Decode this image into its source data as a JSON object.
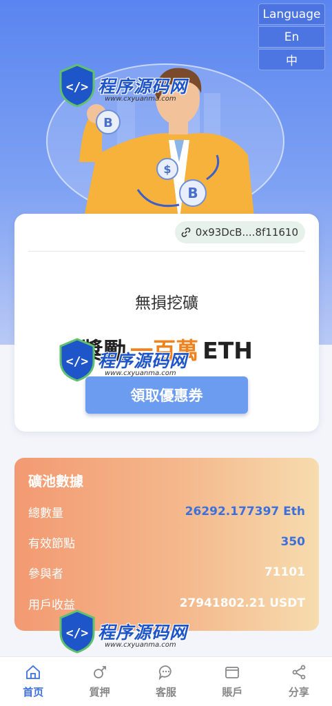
{
  "language": {
    "title": "Language",
    "options": [
      "En",
      "中"
    ]
  },
  "wallet": {
    "address": "0x93DcB....8f11610"
  },
  "hero_card": {
    "heading": "無損挖礦",
    "reward_prefix": "獎勵",
    "reward_amount": "一百萬",
    "reward_unit": "ETH",
    "coupon_button": "領取優惠券"
  },
  "pool": {
    "title": "礦池數據",
    "rows": [
      {
        "label": "總數量",
        "value": "26292.177397 Eth"
      },
      {
        "label": "有效節點",
        "value": "350"
      },
      {
        "label": "參與者",
        "value": "71101"
      },
      {
        "label": "用戶收益",
        "value": "27941802.21 USDT"
      }
    ]
  },
  "watermark": {
    "text": "程序源码网",
    "sub": "www.cxyuanma.com"
  },
  "nav": [
    {
      "label": "首页",
      "icon": "home-icon",
      "active": true
    },
    {
      "label": "質押",
      "icon": "stake-icon",
      "active": false
    },
    {
      "label": "客服",
      "icon": "chat-icon",
      "active": false
    },
    {
      "label": "賬戶",
      "icon": "wallet-icon",
      "active": false
    },
    {
      "label": "分享",
      "icon": "share-icon",
      "active": false
    }
  ],
  "colors": {
    "primary": "#3d6fdc",
    "accent": "#f0821e",
    "button": "#6c9cf0"
  }
}
